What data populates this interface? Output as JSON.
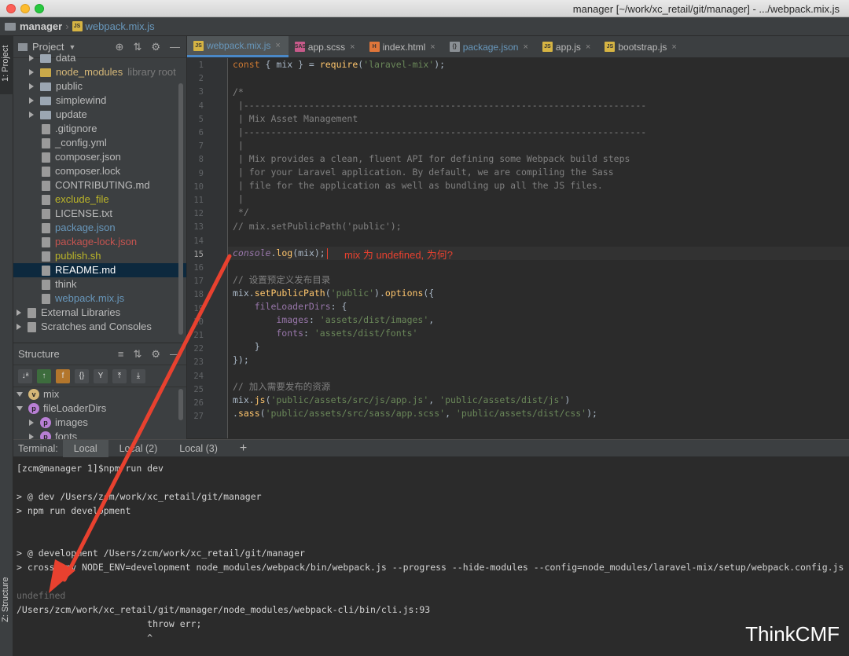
{
  "window": {
    "title": "manager [~/work/xc_retail/git/manager] - .../webpack.mix.js"
  },
  "navbar": {
    "project": "manager",
    "file": "webpack.mix.js"
  },
  "sidebar": {
    "project_tab": "1: Project",
    "structure_tab": "Z: Structure"
  },
  "project_panel": {
    "title": "Project",
    "items": [
      {
        "label": "data",
        "color": "#bbbbbb"
      },
      {
        "label": "node_modules",
        "hint": "library root",
        "color": "#d5b778"
      },
      {
        "label": "public",
        "color": "#bbbbbb"
      },
      {
        "label": "simplewind",
        "color": "#bbbbbb"
      },
      {
        "label": "update",
        "color": "#bbbbbb"
      },
      {
        "label": ".gitignore",
        "color": "#bbbbbb"
      },
      {
        "label": "_config.yml",
        "color": "#bbbbbb"
      },
      {
        "label": "composer.json",
        "color": "#bbbbbb"
      },
      {
        "label": "composer.lock",
        "color": "#bbbbbb"
      },
      {
        "label": "CONTRIBUTING.md",
        "color": "#bbbbbb"
      },
      {
        "label": "exclude_file",
        "color": "#bbb529"
      },
      {
        "label": "LICENSE.txt",
        "color": "#bbbbbb"
      },
      {
        "label": "package.json",
        "color": "#6897bb"
      },
      {
        "label": "package-lock.json",
        "color": "#c75450"
      },
      {
        "label": "publish.sh",
        "color": "#bbb529"
      },
      {
        "label": "README.md",
        "color": "#ffffff"
      },
      {
        "label": "think",
        "color": "#bbbbbb"
      },
      {
        "label": "webpack.mix.js",
        "color": "#6897bb"
      },
      {
        "label": "External Libraries",
        "color": "#bbbbbb"
      },
      {
        "label": "Scratches and Consoles",
        "color": "#bbbbbb"
      }
    ]
  },
  "structure_panel": {
    "title": "Structure",
    "items": [
      {
        "label": "mix",
        "letter": "v"
      },
      {
        "label": "fileLoaderDirs",
        "letter": "p"
      },
      {
        "label": "images",
        "letter": "p"
      },
      {
        "label": "fonts",
        "letter": "p"
      }
    ]
  },
  "tabs": [
    {
      "label": "webpack.mix.js",
      "icon": "JS"
    },
    {
      "label": "app.scss",
      "icon": "SASS"
    },
    {
      "label": "index.html",
      "icon": "H"
    },
    {
      "label": "package.json",
      "icon": "{}"
    },
    {
      "label": "app.js",
      "icon": "JS"
    },
    {
      "label": "bootstrap.js",
      "icon": "JS"
    }
  ],
  "line_numbers": [
    "1",
    "2",
    "3",
    "4",
    "5",
    "6",
    "7",
    "8",
    "9",
    "10",
    "11",
    "12",
    "13",
    "14",
    "15",
    "16",
    "17",
    "18",
    "19",
    "20",
    "21",
    "22",
    "23",
    "24",
    "25",
    "26",
    "27"
  ],
  "code": {
    "l1a": "const",
    "l1b": " { mix } = ",
    "l1c": "require",
    "l1d": "(",
    "l1e": "'laravel-mix'",
    "l1f": ");",
    "l3": "/*",
    "l4": " |--------------------------------------------------------------------------",
    "l5": " | Mix Asset Management",
    "l6": " |--------------------------------------------------------------------------",
    "l7": " |",
    "l8": " | Mix provides a clean, fluent API for defining some Webpack build steps",
    "l9": " | for your Laravel application. By default, we are compiling the Sass",
    "l10": " | file for the application as well as bundling up all the JS files.",
    "l11": " |",
    "l12": " */",
    "l13": "// mix.setPublicPath('public');",
    "l15a": "console",
    "l15b": ".",
    "l15c": "log",
    "l15d": "(mix);",
    "l17": "// 设置预定义发布目录",
    "l18a": "mix.",
    "l18b": "setPublicPath",
    "l18c": "(",
    "l18d": "'public'",
    "l18e": ").",
    "l18f": "options",
    "l18g": "({",
    "l19a": "    fileLoaderDirs",
    "l19b": ": {",
    "l20a": "        images",
    "l20b": ": ",
    "l20c": "'assets/dist/images'",
    "l20d": ",",
    "l21a": "        fonts",
    "l21b": ": ",
    "l21c": "'assets/dist/fonts'",
    "l22": "    }",
    "l23": "});",
    "l25": "// 加入需要发布的资源",
    "l26a": "mix.",
    "l26b": "js",
    "l26c": "(",
    "l26d": "'public/assets/src/js/app.js'",
    "l26e": ", ",
    "l26f": "'public/assets/dist/js'",
    "l26g": ")",
    "l27a": ".",
    "l27b": "sass",
    "l27c": "(",
    "l27d": "'public/assets/src/sass/app.scss'",
    "l27e": ", ",
    "l27f": "'public/assets/dist/css'",
    "l27g": ");"
  },
  "annotation": "mix 为 undefined, 为何?",
  "terminal": {
    "label": "Terminal:",
    "tabs": [
      "Local",
      "Local (2)",
      "Local (3)"
    ],
    "add": "+",
    "lines": [
      "[zcm@manager 1]$npm run dev",
      "",
      "> @ dev /Users/zcm/work/xc_retail/git/manager",
      "> npm run development",
      "",
      "",
      "> @ development /Users/zcm/work/xc_retail/git/manager",
      "> cross-env NODE_ENV=development node_modules/webpack/bin/webpack.js --progress --hide-modules --config=node_modules/laravel-mix/setup/webpack.config.js",
      "",
      "undefined",
      "/Users/zcm/work/xc_retail/git/manager/node_modules/webpack-cli/bin/cli.js:93",
      "                        throw err;",
      "                        ^"
    ]
  },
  "watermark": "ThinkCMF",
  "colors": {
    "annotation_red": "#e8412f",
    "selection_blue": "#0d293e",
    "tab_underline": "#4a88c7"
  }
}
